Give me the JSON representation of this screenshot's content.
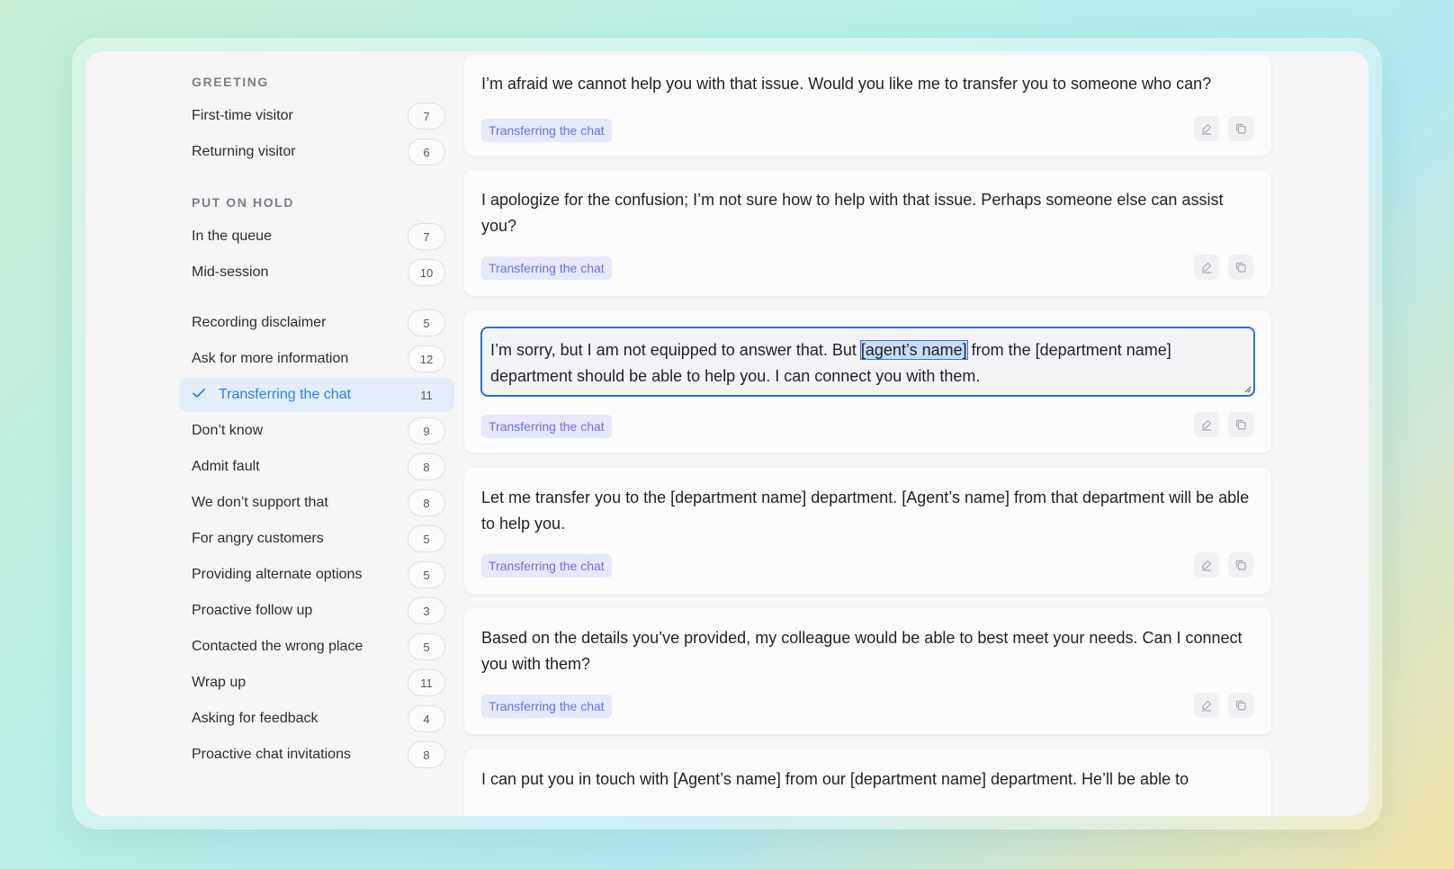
{
  "sidebar": {
    "sections": [
      {
        "title": "GREETING"
      },
      {
        "title": "PUT ON HOLD"
      }
    ],
    "items": [
      {
        "label": "First-time visitor",
        "count": "7"
      },
      {
        "label": "Returning visitor",
        "count": "6"
      },
      {
        "label": "In the queue",
        "count": "7"
      },
      {
        "label": "Mid-session",
        "count": "10"
      },
      {
        "label": "Recording disclaimer",
        "count": "5"
      },
      {
        "label": "Ask for more information",
        "count": "12"
      },
      {
        "label": "Transferring the chat",
        "count": "11",
        "active": true
      },
      {
        "label": "Don’t know",
        "count": "9"
      },
      {
        "label": "Admit fault",
        "count": "8"
      },
      {
        "label": "We don’t support that",
        "count": "8"
      },
      {
        "label": "For angry customers",
        "count": "5"
      },
      {
        "label": "Providing alternate options",
        "count": "5"
      },
      {
        "label": "Proactive follow up",
        "count": "3"
      },
      {
        "label": "Contacted the wrong place",
        "count": "5"
      },
      {
        "label": "Wrap up",
        "count": "11"
      },
      {
        "label": "Asking for feedback",
        "count": "4"
      },
      {
        "label": "Proactive chat invitations",
        "count": "8"
      }
    ]
  },
  "cards": [
    {
      "text": "I’m afraid we cannot help you with that issue. Would you like me to transfer you to someone who can?",
      "tag": "Transferring the chat"
    },
    {
      "text": "I apologize for the confusion; I’m not sure how to help with that issue. Perhaps someone else can assist you?",
      "tag": "Transferring the chat"
    },
    {
      "editing": true,
      "text_before": "I’m sorry, but I am not equipped to answer that. But ",
      "text_selected": "[agent’s name]",
      "text_after": " from the [department name] department should be able to help you. I can connect you with them.",
      "tag": "Transferring the chat"
    },
    {
      "text": "Let me transfer you to the [department name] department. [Agent’s name] from that department will be able to help you.",
      "tag": "Transferring the chat"
    },
    {
      "text": "Based on the details you’ve provided, my colleague would be able to best meet your needs. Can I connect you with them?",
      "tag": "Transferring the chat"
    },
    {
      "text": "I can put you in touch with [Agent’s name] from our [department name] department. He’ll be able to"
    }
  ],
  "icons": {
    "edit": "edit-icon",
    "copy": "copy-icon",
    "check": "check-icon"
  },
  "colors": {
    "accent": "#2d7fe0",
    "tag_bg": "#e6e8fb",
    "tag_text": "#6c71e0",
    "editor_border": "#2f6fd6"
  }
}
